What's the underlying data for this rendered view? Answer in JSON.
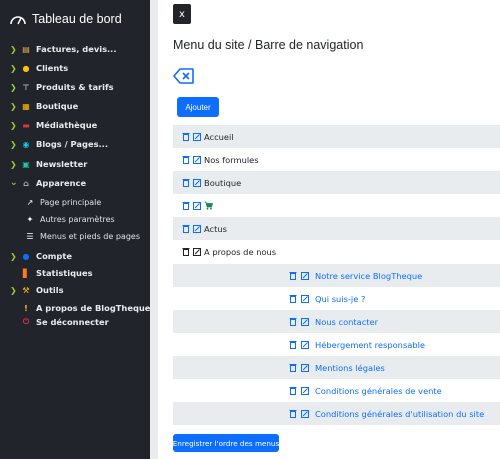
{
  "sidebar": {
    "brand": "Tableau de bord",
    "items": [
      {
        "label": "Factures, devis...",
        "icon": "invoice-icon",
        "expandable": true
      },
      {
        "label": "Clients",
        "icon": "users-icon",
        "expandable": true
      },
      {
        "label": "Produits & tarifs",
        "icon": "tag-icon",
        "expandable": true
      },
      {
        "label": "Boutique",
        "icon": "shop-icon",
        "expandable": true
      },
      {
        "label": "Médiathèque",
        "icon": "media-icon",
        "expandable": true
      },
      {
        "label": "Blogs / Pages...",
        "icon": "globe-icon",
        "expandable": true
      },
      {
        "label": "Newsletter",
        "icon": "newsletter-icon",
        "expandable": true
      },
      {
        "label": "Apparence",
        "icon": "home-icon",
        "expandable": true
      }
    ],
    "sub_items": [
      {
        "label": "Page principale",
        "icon": "pointer-icon"
      },
      {
        "label": "Autres paramètres",
        "icon": "wrench-icon"
      },
      {
        "label": "Menus et pieds de pages",
        "icon": "menu-icon"
      }
    ],
    "items2": [
      {
        "label": "Compte",
        "icon": "account-icon",
        "expandable": true
      },
      {
        "label": "Statistiques",
        "icon": "stats-icon",
        "expandable": false
      },
      {
        "label": "Outils",
        "icon": "tools-icon",
        "expandable": true
      },
      {
        "label": "A propos de BlogTheque",
        "icon": "info-icon",
        "expandable": false
      },
      {
        "label": "Se déconnecter",
        "icon": "power-icon",
        "expandable": false
      }
    ]
  },
  "main": {
    "close_label": "x",
    "title": "Menu du site / Barre de navigation",
    "add_label": "Ajouter",
    "menu_items": [
      {
        "label": "Accueil"
      },
      {
        "label": "Nos formules"
      },
      {
        "label": "Boutique"
      },
      {
        "label": "",
        "icon": "cart-icon"
      },
      {
        "label": "Actus"
      },
      {
        "label": "A propos de nous"
      }
    ],
    "sub_items": [
      {
        "label": "Notre service BlogTheque"
      },
      {
        "label": "Qui suis-je ?"
      },
      {
        "label": "Nous contacter"
      },
      {
        "label": "Hébergement responsable"
      },
      {
        "label": "Mentions légales"
      },
      {
        "label": "Conditions générales de vente"
      },
      {
        "label": "Conditions générales d'utilisation du site"
      }
    ],
    "save_label": "Enregistrer l'ordre des menus"
  },
  "colors": {
    "sidebar_bg": "#21252b",
    "accent": "#0d6efd",
    "chevron": "#9acd32",
    "row_alt": "#e9ecef"
  }
}
